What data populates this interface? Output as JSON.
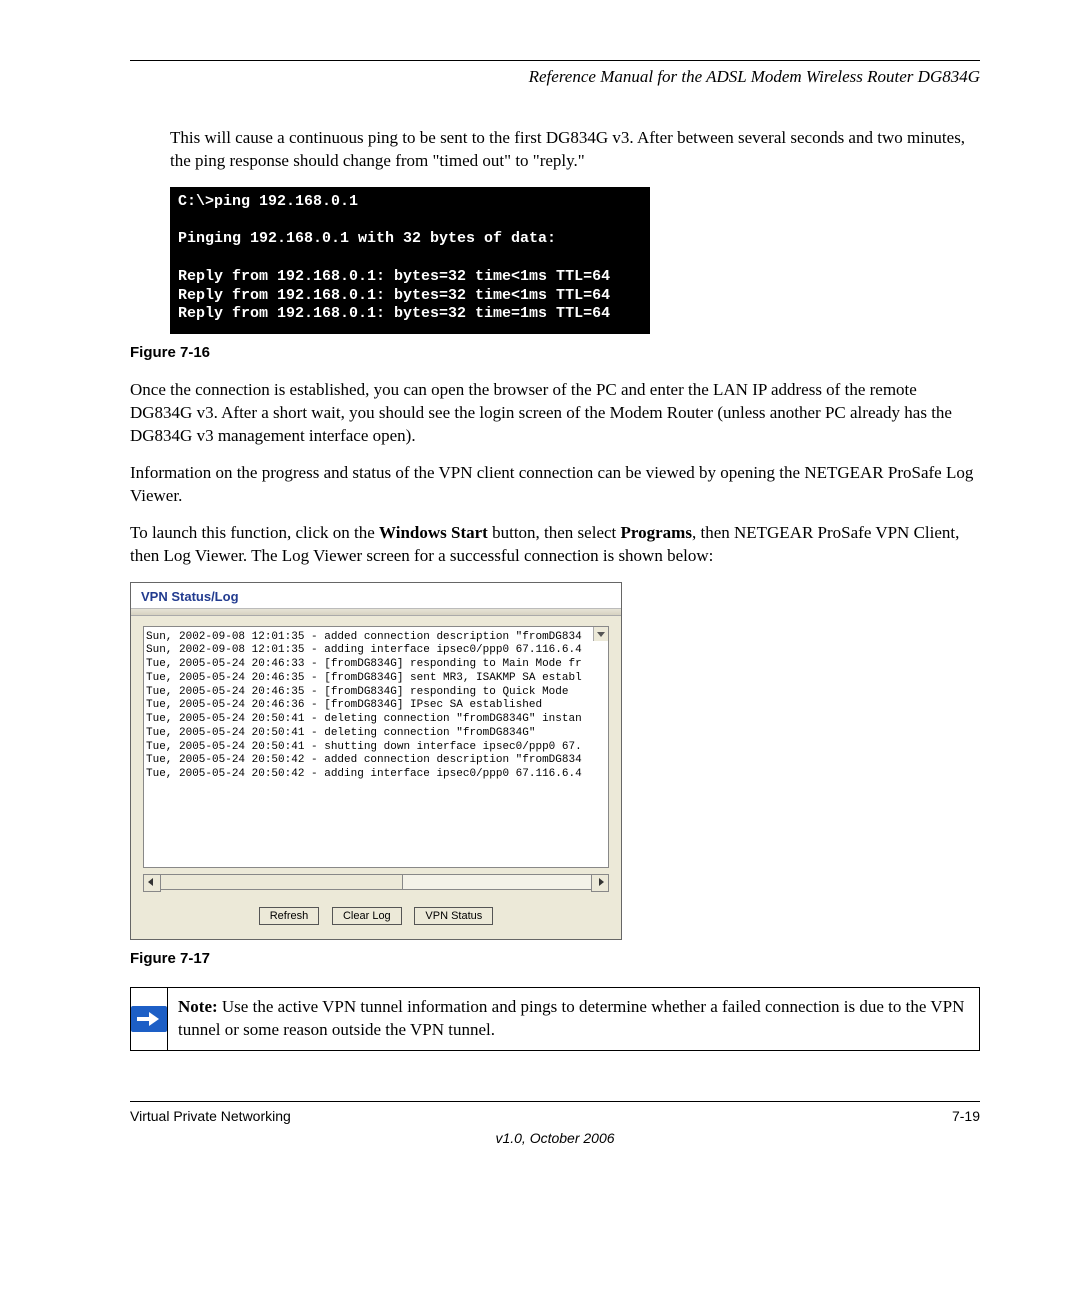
{
  "header": "Reference Manual for the ADSL Modem Wireless Router DG834G",
  "para1": "This will cause a continuous ping to be sent to the first DG834G v3. After between several seconds and two minutes, the ping response should change from \"timed out\" to \"reply.\"",
  "terminal_text": "C:\\>ping 192.168.0.1\n\nPinging 192.168.0.1 with 32 bytes of data:\n\nReply from 192.168.0.1: bytes=32 time<1ms TTL=64\nReply from 192.168.0.1: bytes=32 time<1ms TTL=64\nReply from 192.168.0.1: bytes=32 time=1ms TTL=64",
  "fig16": "Figure 7-16",
  "para2": "Once the connection is established, you can open the browser of the PC and enter the LAN IP address of the remote DG834G v3. After a short wait, you should see the login screen of the Modem Router (unless another PC already has the DG834G v3 management interface open).",
  "para3": "Information on the progress and status of the VPN client connection can be viewed by opening the NETGEAR ProSafe Log Viewer.",
  "para4a": "To launch this function, click on the ",
  "para4b": "Windows Start",
  "para4c": " button, then select ",
  "para4d": "Programs",
  "para4e": ", then NETGEAR ProSafe VPN Client, then Log Viewer. The Log Viewer screen for a successful connection is shown below:",
  "vpn": {
    "title": "VPN Status/Log",
    "lines": "Sun, 2002-09-08 12:01:35 - added connection description \"fromDG834\nSun, 2002-09-08 12:01:35 - adding interface ipsec0/ppp0 67.116.6.4\nTue, 2005-05-24 20:46:33 - [fromDG834G] responding to Main Mode fr\nTue, 2005-05-24 20:46:35 - [fromDG834G] sent MR3, ISAKMP SA establ\nTue, 2005-05-24 20:46:35 - [fromDG834G] responding to Quick Mode\nTue, 2005-05-24 20:46:36 - [fromDG834G] IPsec SA established\nTue, 2005-05-24 20:50:41 - deleting connection \"fromDG834G\" instan\nTue, 2005-05-24 20:50:41 - deleting connection \"fromDG834G\"\nTue, 2005-05-24 20:50:41 - shutting down interface ipsec0/ppp0 67.\nTue, 2005-05-24 20:50:42 - added connection description \"fromDG834\nTue, 2005-05-24 20:50:42 - adding interface ipsec0/ppp0 67.116.6.4",
    "btn_refresh": "Refresh",
    "btn_clear": "Clear Log",
    "btn_status": "VPN Status"
  },
  "fig17": "Figure 7-17",
  "note_label": "Note:",
  "note_text": " Use the active VPN tunnel information and pings to determine whether a failed connection is due to the VPN tunnel or some reason outside the VPN tunnel.",
  "footer_left": "Virtual Private Networking",
  "footer_right": "7-19",
  "footer_version": "v1.0, October 2006"
}
